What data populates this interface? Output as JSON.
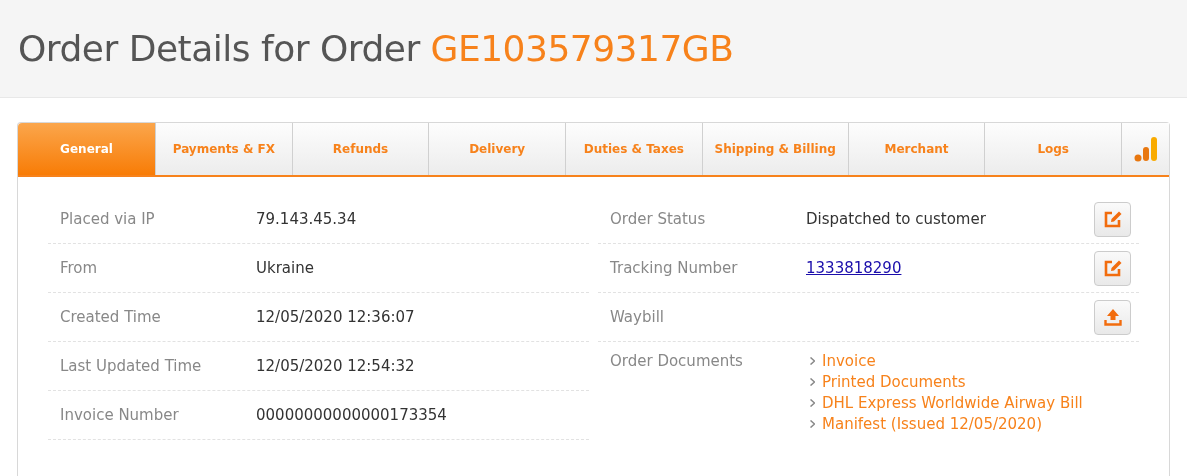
{
  "title": {
    "text": "Order Details for Order",
    "order_id": "GE103579317GB"
  },
  "tabs": [
    {
      "kind": "text",
      "label": "General",
      "selected": true
    },
    {
      "kind": "text",
      "label": "Payments & FX",
      "selected": false
    },
    {
      "kind": "text",
      "label": "Refunds",
      "selected": false
    },
    {
      "kind": "text",
      "label": "Delivery",
      "selected": false
    },
    {
      "kind": "text",
      "label": "Duties & Taxes",
      "selected": false
    },
    {
      "kind": "text",
      "label": "Shipping & Billing",
      "selected": false
    },
    {
      "kind": "text",
      "label": "Merchant",
      "selected": false
    },
    {
      "kind": "text",
      "label": "Logs",
      "selected": false
    },
    {
      "kind": "icon",
      "selected": false
    }
  ],
  "left_fields": [
    {
      "label": "Placed via IP",
      "value": "79.143.45.34"
    },
    {
      "label": "From",
      "value": "Ukraine"
    },
    {
      "label": "Created Time",
      "value": "12/05/2020 12:36:07"
    },
    {
      "label": "Last Updated Time",
      "value": "12/05/2020 12:54:32"
    },
    {
      "label": "Invoice Number",
      "value": "00000000000000173354"
    }
  ],
  "right_fields": [
    {
      "label": "Order Status",
      "kind": "text",
      "value": "Dispatched to customer",
      "button": {
        "kind": "edit"
      }
    },
    {
      "label": "Tracking Number",
      "kind": "link",
      "value": "1333818290",
      "button": {
        "kind": "edit"
      }
    },
    {
      "label": "Waybill",
      "kind": "empty",
      "button": {
        "kind": "upload"
      }
    },
    {
      "label": "Order Documents",
      "kind": "links",
      "links": [
        "Invoice",
        "Printed Documents",
        "DHL Express Worldwide Airway Bill",
        "Manifest (Issued 12/05/2020)"
      ]
    }
  ]
}
